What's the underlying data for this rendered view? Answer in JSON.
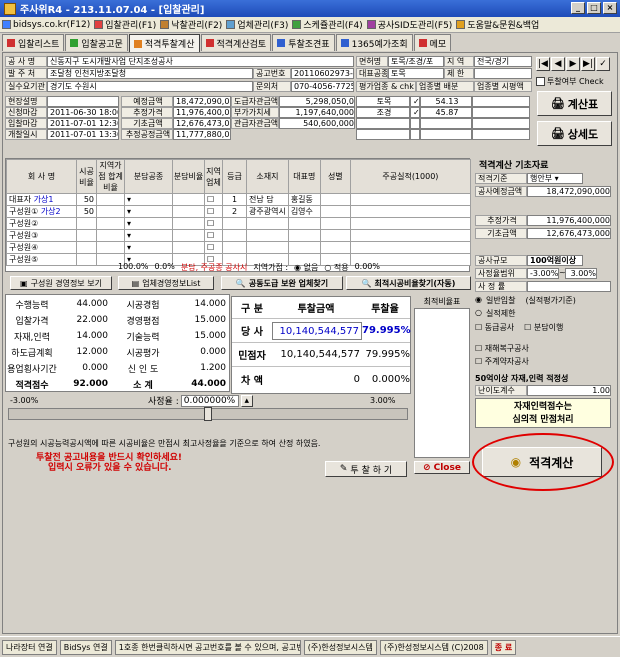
{
  "window": {
    "title": "주사위R4 - 213.11.07.04 - [입찰관리]",
    "min": "_",
    "max": "□",
    "close": "×"
  },
  "menu": [
    "bidsys.co.kr(F12)",
    "입찰관리(F1)",
    "낙찰관리(F2)",
    "업체관리(F3)",
    "스케쥴관리(F4)",
    "공사SID도관리(F5)",
    "도움말&문원&백업"
  ],
  "tabs": [
    "입찰리스트",
    "입찰공고문",
    "적격투찰계산",
    "적격계산검토",
    "투찰조견표",
    "1365예가조회",
    "메모"
  ],
  "info": {
    "l_name": "공 사 명",
    "v_name": "신동지구 도시개발사업 단지조성공사",
    "l_org": "발 주 처",
    "v_org": "조달청 인천지방조달청",
    "l_dept": "실수요기관",
    "v_dept": "경기도 수원시",
    "l_type": "면허명",
    "v_type": "토목/조경/포",
    "l_region": "지 역",
    "v_region": "전국/경기",
    "l_no": "공고번호",
    "v_no": "20110602973-00",
    "l_rep": "대표공종",
    "v_rep": "토목",
    "l_limit": "제 한",
    "v_limit": "",
    "l_contact": "문의처",
    "v_contact": "070-4056-7725",
    "l_eval": "평가업종 & chk",
    "l_share": "업종별 배분",
    "l_market": "업종별 시평액"
  },
  "dates": [
    {
      "l": "현장설명",
      "v": ""
    },
    {
      "l": "신청마감",
      "v": "2011-06-30 18:00"
    },
    {
      "l": "입찰마감",
      "v": "2011-07-01 12:30"
    },
    {
      "l": "개찰일시",
      "v": "2011-07-01 13:30"
    }
  ],
  "amounts": [
    {
      "l": "예정금액",
      "v": "18,472,090,000",
      "l2": "도급자관금액",
      "v2": "5,298,050,0"
    },
    {
      "l": "추정가격",
      "v": "11,976,400,000",
      "l2": "부가가치세",
      "v2": "1,197,640,000"
    },
    {
      "l": "기초금액",
      "v": "12,676,473,000",
      "l2": "관급자관금액",
      "v2": "540,600,000"
    },
    {
      "l": "추정공정금액",
      "v": "11,777,880,000",
      "l2": "",
      "v2": ""
    }
  ],
  "sectors": [
    {
      "name": "토목",
      "val": "54.13"
    },
    {
      "name": "조경",
      "val": "45.87"
    }
  ],
  "bid_yn": "투찰여부 Check",
  "buttons": {
    "calc_table": "계산표",
    "detail": "상세도",
    "close": "Close",
    "bid": "투 찰 하 기",
    "qual_calc": "적격계산",
    "partner_info": "구성원 경영정보 보기",
    "biz_list": "업체경영정보List",
    "co_find": "공동도급 보완 업체찾기",
    "min_ratio": "최적시공비율찾기(자동)"
  },
  "grid": {
    "headers": [
      "회 사 명",
      "시공비율",
      "지역가점 합계비율",
      "분담공종",
      "분담비율",
      "지역업체",
      "등급",
      "소재지",
      "대표명",
      "성별",
      "주공실적(1000)"
    ],
    "rows": [
      {
        "role": "대표자",
        "name": "가상1",
        "ratio": "50",
        "g": "1",
        "loc": "전남 담",
        "rep": "홍길동"
      },
      {
        "role": "구성원①",
        "name": "가상2",
        "ratio": "50",
        "g": "2",
        "loc": "광주광역시",
        "rep": "김영수"
      },
      {
        "role": "구성원②",
        "name": "",
        "ratio": "",
        "g": "",
        "loc": "",
        "rep": ""
      },
      {
        "role": "구성원③",
        "name": "",
        "ratio": "",
        "g": "",
        "loc": "",
        "rep": ""
      },
      {
        "role": "구성원④",
        "name": "",
        "ratio": "",
        "g": "",
        "loc": "",
        "rep": ""
      },
      {
        "role": "구성원⑤",
        "name": "",
        "ratio": "",
        "g": "",
        "loc": "",
        "rep": ""
      }
    ],
    "total": "100.0%",
    "total2": "0.0%",
    "warn": "분담, 주공종 공사시",
    "region_label": "지역가점 :",
    "opt1": "없음",
    "opt2": "적용",
    "pct": "0.00%"
  },
  "scores": [
    {
      "l": "수행능력",
      "v": "44.000",
      "l2": "시공경험",
      "v2": "14.000"
    },
    {
      "l": "입찰가격",
      "v": "22.000",
      "l2": "경영평점",
      "v2": "15.000"
    },
    {
      "l": "자재,인력",
      "v": "14.000",
      "l2": "기술능력",
      "v2": "15.000"
    },
    {
      "l": "하도급계획",
      "v": "12.000",
      "l2": "시공평가",
      "v2": "0.000"
    },
    {
      "l": "용업횡사기간",
      "v": "0.000",
      "l2": "신 인 도",
      "v2": "1.200"
    },
    {
      "l": "적격점수",
      "v": "92.000",
      "l2": "소 계",
      "v2": "44.000"
    }
  ],
  "calc": {
    "h1": "구 분",
    "h2": "투찰금액",
    "h3": "투찰율",
    "r1l": "당 사",
    "r1v": "10,140,544,577",
    "r1p": "79.995%",
    "r2l": "민점자",
    "r2v": "10,140,544,577",
    "r2p": "79.995%",
    "r3l": "차 액",
    "r3v": "0",
    "r3p": "0.000%",
    "low": "-3.00%",
    "high": "3.00%",
    "rate_l": "사정율 :",
    "rate_v": "0.000000%",
    "list_title": "최적비율표"
  },
  "right": {
    "title": "적격계산 기초자료",
    "l1": "적격기준",
    "v1": "행안부",
    "l2": "공사예정금액",
    "v2": "18,472,090,000",
    "l3": "추정가격",
    "v3": "11,976,400,000",
    "l4": "기초금액",
    "v4": "12,676,473,000",
    "l5": "공사규모",
    "v5": "100억원이상",
    "l6": "사정율범위",
    "v6a": "-3.00%",
    "v6b": "3.00%",
    "l7": "사 정 률",
    "v7": "",
    "r1": "일반입찰",
    "r1b": "(실적평가기준)",
    "r2": "실적제한",
    "c1": "동급공사",
    "c2": "분담이행",
    "c3": "재해복구공사",
    "c4": "주계약자공사",
    "mat_title": "50억이상 자재,인력 적정성",
    "mat_l": "난이도계수",
    "mat_v": "1.00",
    "mat_note1": "자재인력점수는",
    "mat_note2": "심의적 만점처리"
  },
  "notes": {
    "n1": "구성원의 시공능력공시액에 따른 시공비율은 만점시 최고사정율을 기준으로 하여 산정 하였음.",
    "n2": "투찰전 공고내용을 반드시 확인하세요!",
    "n3": "입력시 오류가 있을 수 있습니다."
  },
  "status": [
    "나라장터 연결",
    "BidSys 연결",
    "1호종 한번클릭하시면 공고번호를 볼 수 있으며, 공고번호순",
    "(주)한성정보시스템",
    "(주)한성정보시스템 (C)2008",
    "종 료"
  ]
}
